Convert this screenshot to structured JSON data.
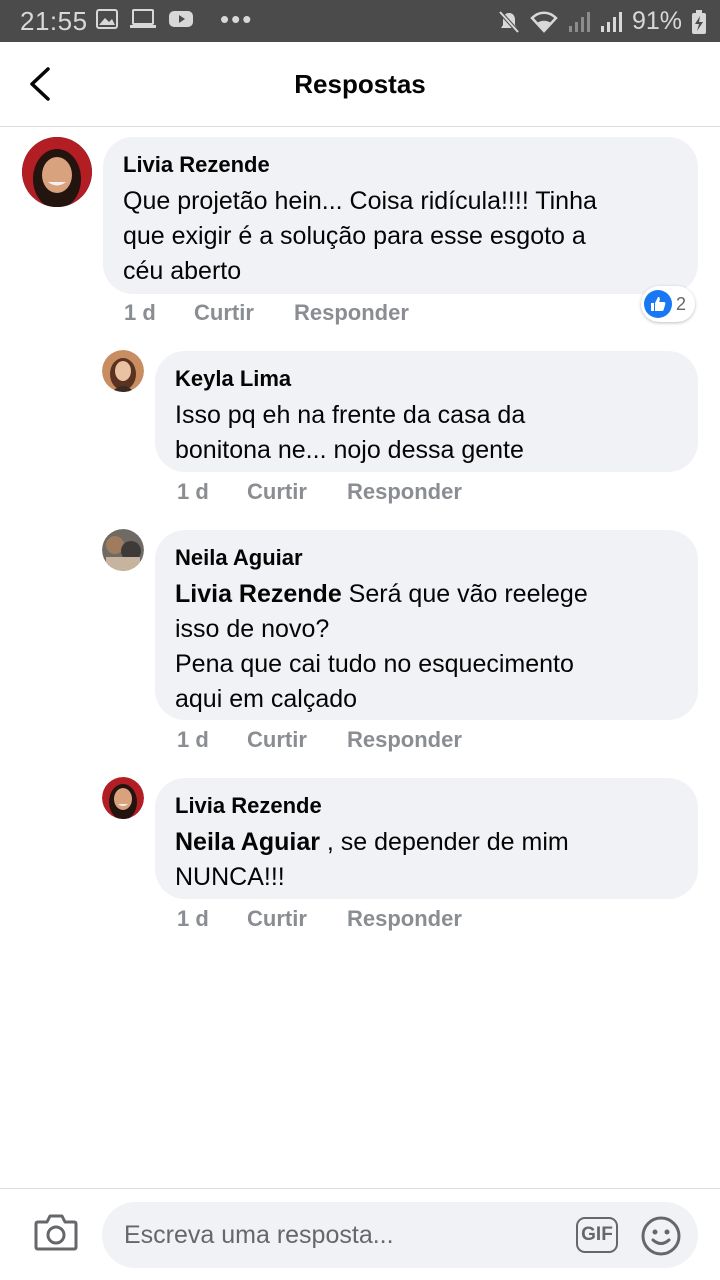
{
  "status_bar": {
    "time": "21:55",
    "battery": "91%",
    "icons": [
      "image-icon",
      "cast-icon",
      "youtube-icon",
      "more-icon",
      "mute-icon",
      "wifi-icon",
      "signal-icon",
      "signal-icon",
      "battery-charging-icon"
    ]
  },
  "header": {
    "title": "Respostas",
    "back_icon": "chevron-left-icon"
  },
  "comments": [
    {
      "author": "Livia Rezende",
      "lines": [
        "Que projetão hein... Coisa ridícula!!!! Tinha",
        "que exigir é a solução para esse esgoto a",
        "céu aberto"
      ],
      "time": "1 d",
      "like": "Curtir",
      "reply": "Responder",
      "reactions": "2"
    },
    {
      "author": "Keyla Lima",
      "lines": [
        "Isso pq eh na frente da casa da",
        "bonitona  ne... nojo dessa gente"
      ],
      "time": "1 d",
      "like": "Curtir",
      "reply": "Responder"
    },
    {
      "author": "Neila Aguiar",
      "mention": "Livia Rezende",
      "lines": [
        " Será que vão reelege",
        "isso de novo?",
        "Pena que cai tudo no esquecimento",
        "aqui em calçado"
      ],
      "time": "1 d",
      "like": "Curtir",
      "reply": "Responder"
    },
    {
      "author": "Livia Rezende",
      "mention": "Neila Aguiar",
      "lines": [
        " , se depender de mim",
        "NUNCA!!!"
      ],
      "time": "1 d",
      "like": "Curtir",
      "reply": "Responder"
    }
  ],
  "composer": {
    "placeholder": "Escreva uma resposta...",
    "gif_label": "GIF",
    "camera_icon": "camera-icon",
    "emoji_icon": "smiley-icon"
  },
  "colors": {
    "bubble": "#f0f2f5",
    "meta_text": "#8a8d91",
    "like_blue": "#1877f2",
    "status_bar": "#4b4b4b"
  }
}
